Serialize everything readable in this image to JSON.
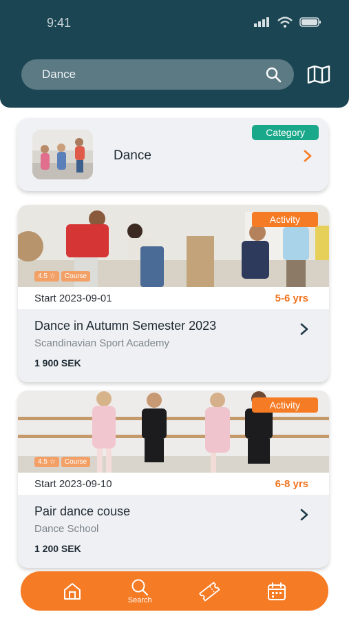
{
  "status_bar": {
    "time": "9:41"
  },
  "search": {
    "value": "Dance"
  },
  "category_card": {
    "badge": "Category",
    "title": "Dance"
  },
  "activities": [
    {
      "badge": "Activity",
      "rating": "4.5",
      "type_tag": "Course",
      "start": "Start 2023-09-01",
      "age": "5-6 yrs",
      "title": "Dance in Autumn Semester 2023",
      "organizer": "Scandinavian Sport Academy",
      "price": "1 900 SEK"
    },
    {
      "badge": "Activity",
      "rating": "4.5",
      "type_tag": "Course",
      "start": "Start 2023-09-10",
      "age": "6-8 yrs",
      "title": "Pair dance couse",
      "organizer": "Dance School",
      "price": "1 200 SEK"
    }
  ],
  "bottom_nav": {
    "items": [
      {
        "icon": "home-icon",
        "label": ""
      },
      {
        "icon": "search-icon",
        "label": "Search"
      },
      {
        "icon": "ticket-icon",
        "label": ""
      },
      {
        "icon": "calendar-icon",
        "label": ""
      }
    ]
  },
  "colors": {
    "header": "#1b4552",
    "accent_orange": "#f57b25",
    "category_green": "#1aa88a"
  }
}
